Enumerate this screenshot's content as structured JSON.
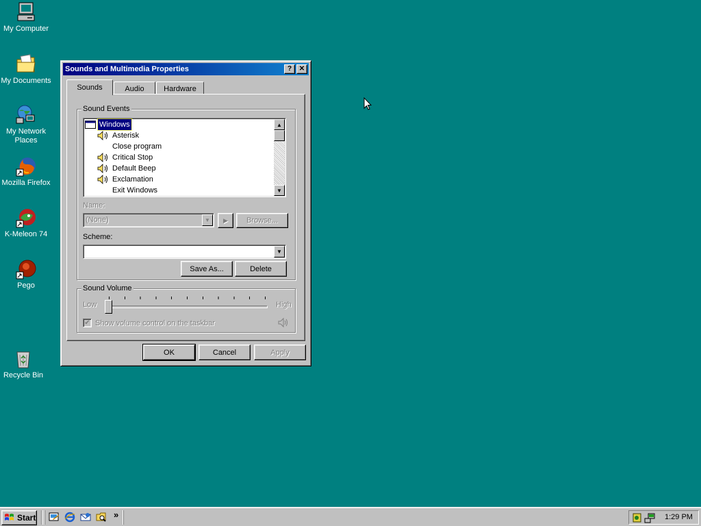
{
  "desktop": {
    "icons": [
      {
        "label": "My Computer",
        "icon": "my-computer-icon"
      },
      {
        "label": "My Documents",
        "icon": "folder-icon"
      },
      {
        "label": "My Network Places",
        "icon": "network-icon"
      },
      {
        "label": "Mozilla Firefox",
        "icon": "firefox-icon"
      },
      {
        "label": "K-Meleon 74",
        "icon": "k-meleon-icon"
      },
      {
        "label": "Pego",
        "icon": "pego-icon"
      },
      {
        "label": "Recycle Bin",
        "icon": "recycle-bin-icon"
      }
    ],
    "background_color": "#008080"
  },
  "window": {
    "title": "Sounds and Multimedia Properties",
    "help_label": "?",
    "close_label": "✕",
    "tabs": [
      {
        "label": "Sounds",
        "active": true
      },
      {
        "label": "Audio",
        "active": false
      },
      {
        "label": "Hardware",
        "active": false
      }
    ],
    "sound_events": {
      "group_label": "Sound Events",
      "items": [
        {
          "label": "Windows",
          "selected": true,
          "has_sound": false,
          "is_category": true
        },
        {
          "label": "Asterisk",
          "has_sound": true
        },
        {
          "label": "Close program",
          "has_sound": false
        },
        {
          "label": "Critical Stop",
          "has_sound": true
        },
        {
          "label": "Default Beep",
          "has_sound": true
        },
        {
          "label": "Exclamation",
          "has_sound": true
        },
        {
          "label": "Exit Windows",
          "has_sound": false
        }
      ]
    },
    "name_label": "Name:",
    "name_value": "(None)",
    "play_icon": "play-icon",
    "browse_label": "Browse...",
    "scheme_label": "Scheme:",
    "scheme_value": "",
    "save_as_label": "Save As...",
    "delete_label": "Delete",
    "sound_volume": {
      "group_label": "Sound Volume",
      "low_label": "Low",
      "high_label": "High",
      "level": 0,
      "show_volume_label": "Show volume control on the taskbar",
      "show_volume_checked": true
    },
    "ok_label": "OK",
    "cancel_label": "Cancel",
    "apply_label": "Apply"
  },
  "taskbar": {
    "start_label": "Start",
    "quick_launch": [
      "show-desktop-icon",
      "internet-explorer-icon",
      "outlook-express-icon",
      "windows-explorer-icon"
    ],
    "more_label": "»",
    "clock": "1:29 PM"
  }
}
